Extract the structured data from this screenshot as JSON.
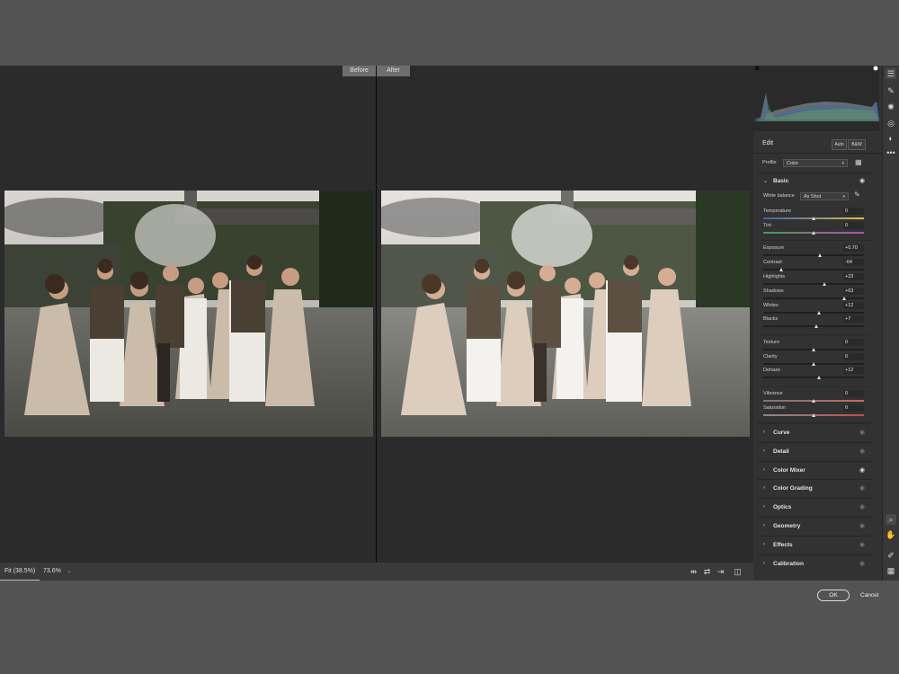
{
  "view": {
    "before_label": "Before",
    "after_label": "After"
  },
  "statusbar": {
    "fit_label": "Fit (38.5%)",
    "zoom_label": "73.6%",
    "zoom_dropdown": "⌄"
  },
  "edit_panel": {
    "title": "Edit",
    "auto_label": "Auto",
    "bw_label": "B&W",
    "profile_label": "Profile",
    "profile_value": "Color",
    "basic": {
      "title": "Basic",
      "white_balance_label": "White balance",
      "white_balance_value": "As Shot",
      "sliders": [
        {
          "label": "Temperature",
          "value": "0",
          "level": 0.5
        },
        {
          "label": "Tint",
          "value": "0",
          "level": 0.5
        },
        {
          "label": "Exposure",
          "value": "+0.70",
          "level": 0.57
        },
        {
          "label": "Contrast",
          "value": "-64",
          "level": 0.18
        },
        {
          "label": "Highlights",
          "value": "+23",
          "level": 0.61
        },
        {
          "label": "Shadows",
          "value": "+63",
          "level": 0.81
        },
        {
          "label": "Whites",
          "value": "+12",
          "level": 0.56
        },
        {
          "label": "Blacks",
          "value": "+7",
          "level": 0.53
        },
        {
          "label": "Texture",
          "value": "0",
          "level": 0.5
        },
        {
          "label": "Clarity",
          "value": "0",
          "level": 0.5
        },
        {
          "label": "Dehaze",
          "value": "+12",
          "level": 0.56
        },
        {
          "label": "Vibrance",
          "value": "0",
          "level": 0.5
        },
        {
          "label": "Saturation",
          "value": "0",
          "level": 0.5
        }
      ]
    },
    "sections": [
      {
        "name": "Curve",
        "eye_active": false
      },
      {
        "name": "Detail",
        "eye_active": false
      },
      {
        "name": "Color Mixer",
        "eye_active": true
      },
      {
        "name": "Color Grading",
        "eye_active": false
      },
      {
        "name": "Optics",
        "eye_active": false
      },
      {
        "name": "Geometry",
        "eye_active": false
      },
      {
        "name": "Effects",
        "eye_active": false
      },
      {
        "name": "Calibration",
        "eye_active": false
      }
    ]
  },
  "dialog": {
    "ok_label": "OK",
    "cancel_label": "Cancel"
  },
  "colors": {
    "canvas_bg": "#2b2b2b",
    "panel_bg": "#323232",
    "app_bg": "#535353"
  }
}
